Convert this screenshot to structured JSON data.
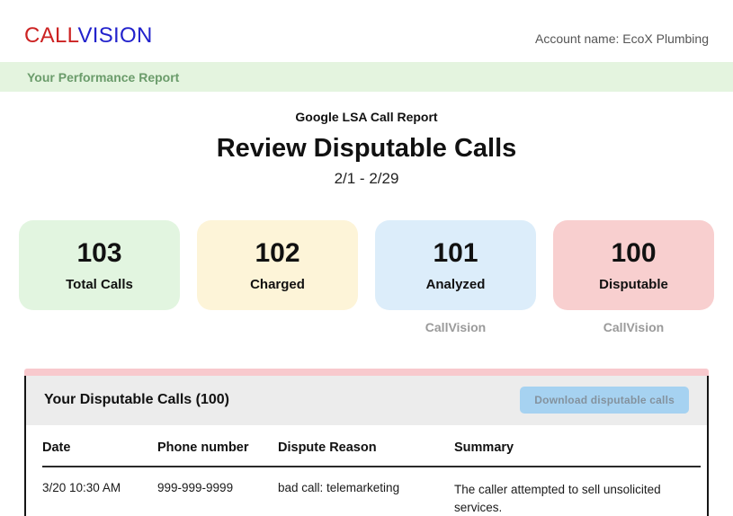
{
  "header": {
    "logo_call": "CALL",
    "logo_vision": "VISION",
    "account_label": "Account name: EcoX Plumbing"
  },
  "banner": {
    "title": "Your Performance Report"
  },
  "report": {
    "subtitle": "Google LSA Call Report",
    "title": "Review Disputable Calls",
    "date_range": "2/1 - 2/29"
  },
  "stats": {
    "cards": [
      {
        "value": "103",
        "label": "Total Calls",
        "color": "#e2f5e0"
      },
      {
        "value": "102",
        "label": "Charged",
        "color": "#fdf4d8"
      },
      {
        "value": "101",
        "label": "Analyzed",
        "color": "#dcedfa"
      },
      {
        "value": "100",
        "label": "Disputable",
        "color": "#f8cfcf"
      }
    ],
    "watermarks": [
      "CallVision",
      "CallVision"
    ]
  },
  "disputable": {
    "title": "Your Disputable Calls (100)",
    "download_button": "Download disputable calls",
    "columns": [
      "Date",
      "Phone number",
      "Dispute Reason",
      "Summary"
    ],
    "rows": [
      {
        "date": "3/20 10:30 AM",
        "phone": "999-999-9999",
        "reason": "bad call: telemarketing",
        "summary": "The caller attempted to sell unsolicited services."
      }
    ]
  },
  "colors": {
    "logo_red": "#cc2222",
    "logo_blue": "#2222cc",
    "banner_bg": "#e4f4df",
    "banner_text": "#6b9c6b",
    "panel_accent_pink": "#f8c9cd",
    "button_bg": "#a6d2f1",
    "button_text": "#84929e"
  }
}
